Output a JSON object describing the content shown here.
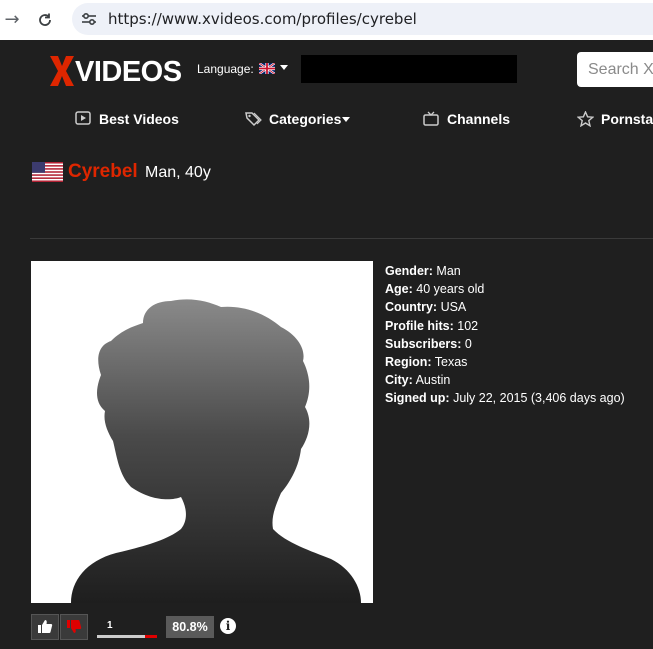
{
  "browser": {
    "url": "https://www.xvideos.com/profiles/cyrebel",
    "icons": [
      "back-arrow-icon",
      "reload-icon",
      "site-settings-icon"
    ]
  },
  "header": {
    "logo_text": "VIDEOS",
    "language_label": "Language:",
    "search_placeholder": "Search X"
  },
  "nav": {
    "items": [
      {
        "label": "Best Videos",
        "icon": "play-icon"
      },
      {
        "label": "Categories",
        "icon": "tag-icon"
      },
      {
        "label": "Channels",
        "icon": "tv-icon"
      },
      {
        "label": "Pornstar",
        "icon": "star-icon"
      }
    ]
  },
  "profile": {
    "name": "Cyrebel",
    "subtitle": "Man, 40y",
    "country_flag": "us-flag-icon",
    "fields": [
      {
        "label": "Gender:",
        "value": "Man"
      },
      {
        "label": "Age:",
        "value": "40 years old"
      },
      {
        "label": "Country:",
        "value": "USA"
      },
      {
        "label": "Profile hits:",
        "value": "102"
      },
      {
        "label": "Subscribers:",
        "value": "0"
      },
      {
        "label": "Region:",
        "value": "Texas"
      },
      {
        "label": "City:",
        "value": "Austin"
      },
      {
        "label": "Signed up:",
        "value": "July 22, 2015 (3,406 days ago)"
      }
    ]
  },
  "votes": {
    "count": "1",
    "percent": "80.8%",
    "positive_ratio": 0.808
  },
  "colors": {
    "accent": "#de2600",
    "background": "#1f1f1f"
  }
}
